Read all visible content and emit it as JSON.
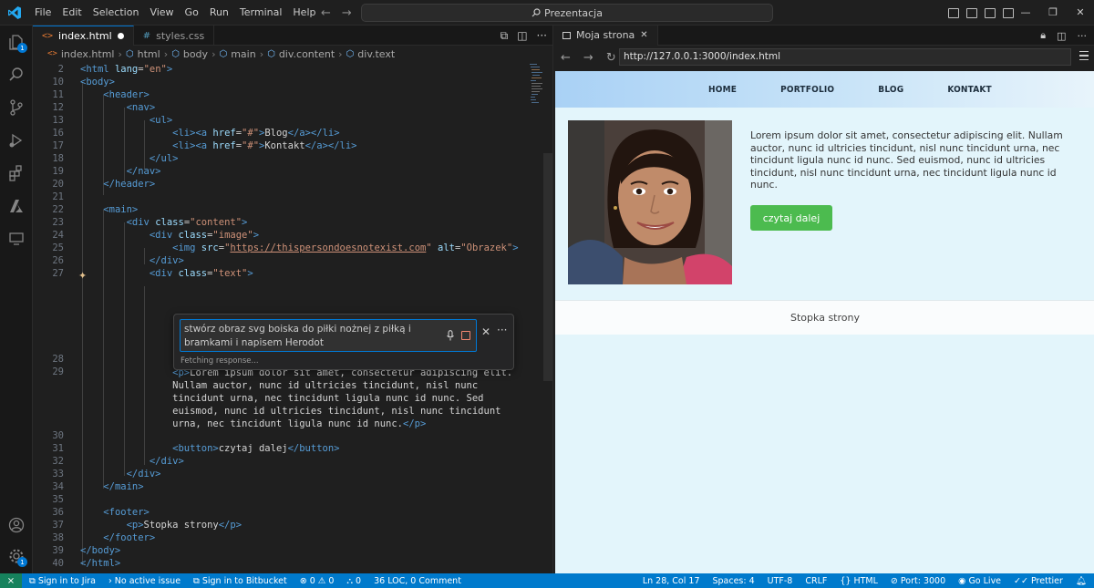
{
  "app": {
    "menu": [
      "File",
      "Edit",
      "Selection",
      "View",
      "Go",
      "Run",
      "Terminal",
      "Help"
    ],
    "command_center": "Prezentacja"
  },
  "activity_bar": {
    "icons": [
      "explorer-icon",
      "search-icon",
      "source-control-icon",
      "run-debug-icon",
      "extensions-icon",
      "azure-icon",
      "remote-explorer-icon",
      "account-icon",
      "manage-gear-icon"
    ],
    "explorer_badge": "1",
    "manage_badge": "1"
  },
  "editor": {
    "tabs": [
      {
        "label": "index.html",
        "active": true,
        "modified": true
      },
      {
        "label": "styles.css",
        "active": false
      }
    ],
    "breadcrumb": [
      "index.html",
      "html",
      "body",
      "main",
      "div.content",
      "div.text"
    ]
  },
  "code": {
    "line_numbers": [
      "2",
      "10",
      "11",
      "12",
      "13",
      "16",
      "17",
      "18",
      "19",
      "20",
      "21",
      "22",
      "23",
      "24",
      "25",
      "26",
      "27",
      "28",
      "29",
      "30",
      "31",
      "32",
      "33",
      "34",
      "35",
      "36",
      "37",
      "38",
      "39",
      "40"
    ]
  },
  "inline_chat": {
    "prompt": "stwórz obraz svg boiska do piłki nożnej z piłką i bramkami i napisem Herodot",
    "status": "Fetching response..."
  },
  "browser": {
    "tab_title": "Moja strona",
    "url": "http://127.0.0.1:3000/index.html",
    "site": {
      "nav": [
        "HOME",
        "PORTFOLIO",
        "BLOG",
        "KONTAKT"
      ],
      "image_alt": "Obrazek",
      "text": "Lorem ipsum dolor sit amet, consectetur adipiscing elit. Nullam auctor, nunc id ultricies tincidunt, nisl nunc tincidunt urna, nec tincidunt ligula nunc id nunc. Sed euismod, nunc id ultricies tincidunt, nisl nunc tincidunt urna, nec tincidunt ligula nunc id nunc.",
      "button": "czytaj dalej",
      "footer": "Stopka strony"
    }
  },
  "status_bar": {
    "left": [
      "Sign in to Jira",
      "No active issue",
      "Sign in to Bitbucket",
      "0",
      "0",
      "0",
      "36 LOC, 0 Comment"
    ],
    "right": [
      "Ln 28, Col 17",
      "Spaces: 4",
      "UTF-8",
      "CRLF",
      "HTML",
      "Port: 3000",
      "Go Live",
      "Prettier"
    ]
  },
  "colors": {
    "accent": "#0078d4",
    "status_bar": "#007acc",
    "remote": "#16825d",
    "site_button": "#4cbb4f",
    "site_header": "#a9d1f5"
  }
}
